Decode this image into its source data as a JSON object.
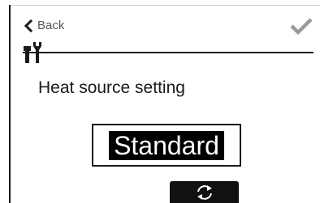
{
  "header": {
    "back_label": "Back",
    "back_icon": "chevron-left-icon",
    "confirm_icon": "checkmark-icon",
    "section_icon": "tools-icon"
  },
  "main": {
    "title": "Heat source setting",
    "selected_value": "Standard"
  },
  "footer": {
    "change_icon": "refresh-icon"
  },
  "colors": {
    "text": "#1a1a1a",
    "secondary_text": "#555555",
    "highlight_bg": "#000000",
    "highlight_text": "#ffffff",
    "confirm_icon": "#9a9a9a",
    "background": "#ffffff"
  }
}
